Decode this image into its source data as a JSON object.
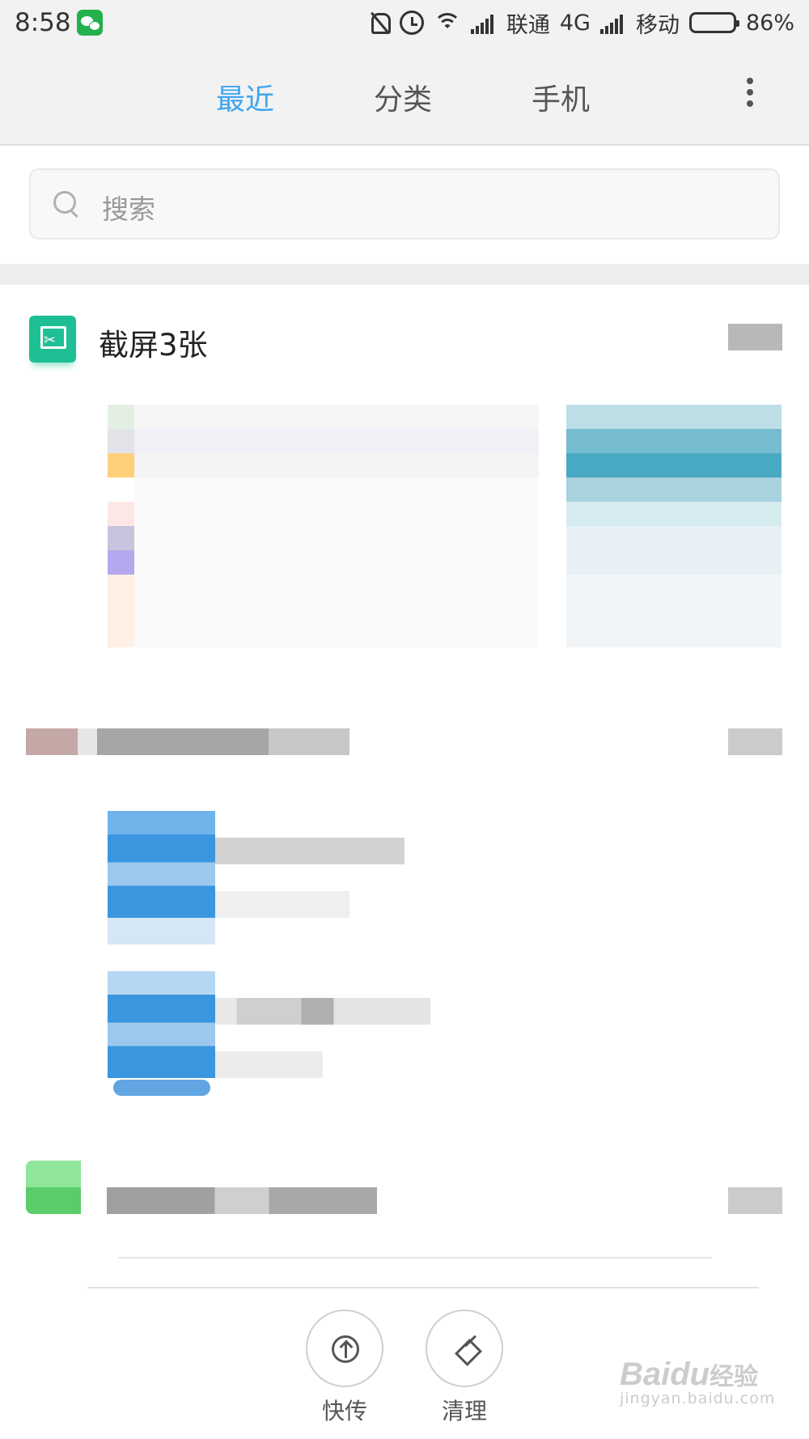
{
  "status_bar": {
    "time": "8:58",
    "carrier1": "联通",
    "network": "4G",
    "carrier2": "移动",
    "battery": "86%",
    "battery_level": 0.86,
    "icons": [
      "wechat-icon",
      "mute-bell-icon",
      "alarm-icon",
      "wifi-icon",
      "signal-icon",
      "battery-icon"
    ]
  },
  "tabs": [
    {
      "label": "最近",
      "active": true
    },
    {
      "label": "分类",
      "active": false
    },
    {
      "label": "手机",
      "active": false
    }
  ],
  "search": {
    "placeholder": "搜索"
  },
  "group": {
    "title": "截屏3张"
  },
  "bottom_actions": [
    {
      "label": "快传",
      "icon": "upload-icon"
    },
    {
      "label": "清理",
      "icon": "brush-icon"
    }
  ],
  "watermark": {
    "logo": "Baidu",
    "cn": "经验",
    "url": "jingyan.baidu.com"
  },
  "colors": {
    "accent": "#3fa6ee",
    "screenshot_icon": "#1fbf96",
    "header_bg": "#f2f2f2"
  }
}
